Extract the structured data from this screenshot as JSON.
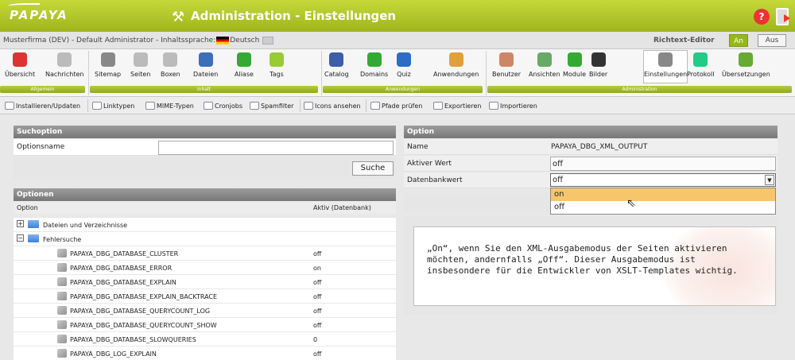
{
  "brand": "PAPAYA",
  "title": "Administration - Einstellungen",
  "info": {
    "left": "Musterfirma (DEV) - Default Administrator - Inhaltssprache:",
    "lang": "Deutsch",
    "richtext": "Richtext-Editor",
    "on": "An",
    "off": "Aus"
  },
  "groups": [
    "Allgemein",
    "Inhalt",
    "Anwendungen",
    "Administration"
  ],
  "toolbar": [
    "Übersicht",
    "Nachrichten",
    "Sitemap",
    "Seiten",
    "Boxen",
    "Dateien",
    "Aliase",
    "Tags",
    "Catalog",
    "Domains",
    "Quiz",
    "Anwendungen",
    "Benutzer",
    "Ansichten",
    "Module",
    "Bilder",
    "Einstellungen",
    "Protokoll",
    "Übersetzungen"
  ],
  "toolbar2": [
    "Installieren/Updaten",
    "Linktypen",
    "MIME-Typen",
    "Cronjobs",
    "Spamfilter",
    "Icons ansehen",
    "Pfade prüfen",
    "Exportieren",
    "Importieren"
  ],
  "suche": {
    "header": "Suchoption",
    "label": "Optionsname",
    "value": "",
    "button": "Suche"
  },
  "optionen": {
    "header": "Optionen",
    "col_option": "Option",
    "col_aktiv": "Aktiv (Datenbank)",
    "rows": [
      {
        "type": "folder",
        "name": "Dateien und Verzeichnisse",
        "sign": "+"
      },
      {
        "type": "folder",
        "name": "Fehlersuche",
        "sign": "−"
      },
      {
        "type": "opt",
        "name": "PAPAYA_DBG_DATABASE_CLUSTER",
        "val": "off"
      },
      {
        "type": "opt",
        "name": "PAPAYA_DBG_DATABASE_ERROR",
        "val": "on"
      },
      {
        "type": "opt",
        "name": "PAPAYA_DBG_DATABASE_EXPLAIN",
        "val": "off"
      },
      {
        "type": "opt",
        "name": "PAPAYA_DBG_DATABASE_EXPLAIN_BACKTRACE",
        "val": "off"
      },
      {
        "type": "opt",
        "name": "PAPAYA_DBG_DATABASE_QUERYCOUNT_LOG",
        "val": "off"
      },
      {
        "type": "opt",
        "name": "PAPAYA_DBG_DATABASE_QUERYCOUNT_SHOW",
        "val": "off"
      },
      {
        "type": "opt",
        "name": "PAPAYA_DBG_DATABASE_SLOWQUERIES",
        "val": "0"
      },
      {
        "type": "opt",
        "name": "PAPAYA_DBG_LOG_EXPLAIN",
        "val": "off"
      }
    ]
  },
  "option": {
    "header": "Option",
    "name_label": "Name",
    "name_value": "PAPAYA_DBG_XML_OUTPUT",
    "aktiv_label": "Aktiver Wert",
    "aktiv_value": "off",
    "db_label": "Datenbankwert",
    "db_value": "off",
    "options": [
      "on",
      "off"
    ]
  },
  "hint": "„On“, wenn Sie den XML-Ausgabemodus der Seiten aktivieren möchten, andernfalls „Off“. Dieser Ausgabemodus ist insbesondere für die Entwickler von XSLT-Templates wichtig.",
  "colors": {
    "accent": "#a2b81f",
    "header_grey": "#8a8a8a",
    "highlight": "#f5c76a"
  }
}
